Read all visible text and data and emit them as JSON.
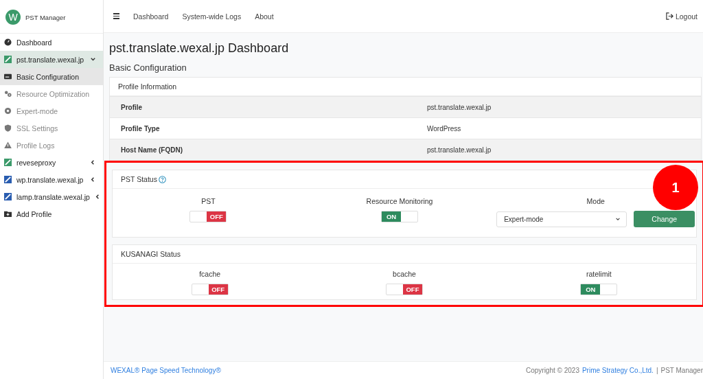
{
  "brand": {
    "logo": "W",
    "name": "PST Manager"
  },
  "sidebar": {
    "items": [
      {
        "kind": "link",
        "label": "Dashboard",
        "selected": false,
        "disabled": false
      },
      {
        "kind": "profile",
        "label": "pst.translate.wexal.jp",
        "selected": false,
        "expanded": true,
        "color": "#3b9a6a"
      },
      {
        "kind": "page",
        "label": "Basic Configuration",
        "selected": true,
        "disabled": false
      },
      {
        "kind": "page",
        "label": "Resource Optimization",
        "selected": false,
        "disabled": true
      },
      {
        "kind": "page",
        "label": "Expert-mode",
        "selected": false,
        "disabled": true
      },
      {
        "kind": "page",
        "label": "SSL Settings",
        "selected": false,
        "disabled": true
      },
      {
        "kind": "page",
        "label": "Profile Logs",
        "selected": false,
        "disabled": true
      },
      {
        "kind": "profile",
        "label": "reveseproxy",
        "selected": false,
        "expanded": false,
        "color": "#3b9a6a"
      },
      {
        "kind": "profile",
        "label": "wp.translate.wexal.jp",
        "selected": false,
        "expanded": false,
        "color": "#2a5db0"
      },
      {
        "kind": "profile",
        "label": "lamp.translate.wexal.jp",
        "selected": false,
        "expanded": false,
        "color": "#2a5db0"
      },
      {
        "kind": "link",
        "label": "Add Profile",
        "selected": false,
        "disabled": false
      }
    ]
  },
  "topbar": {
    "links": [
      "Dashboard",
      "System-wide Logs",
      "About"
    ],
    "logout": "Logout"
  },
  "page_title": "pst.translate.wexal.jp Dashboard",
  "section_title": "Basic Configuration",
  "profile_card": {
    "title": "Profile Information",
    "rows": [
      {
        "label": "Profile",
        "value": "pst.translate.wexal.jp"
      },
      {
        "label": "Profile Type",
        "value": "WordPress"
      },
      {
        "label": "Host Name (FQDN)",
        "value": "pst.translate.wexal.jp"
      }
    ]
  },
  "pst_status": {
    "title": "PST Status",
    "toggles": [
      {
        "label": "PST",
        "on": false,
        "text": "OFF"
      },
      {
        "label": "Resource Monitoring",
        "on": true,
        "text": "ON"
      }
    ],
    "mode": {
      "label": "Mode",
      "value": "Expert-mode",
      "button": "Change"
    }
  },
  "kusanagi_status": {
    "title": "KUSANAGI Status",
    "toggles": [
      {
        "label": "fcache",
        "on": false,
        "text": "OFF"
      },
      {
        "label": "bcache",
        "on": false,
        "text": "OFF"
      },
      {
        "label": "ratelimit",
        "on": true,
        "text": "ON"
      }
    ]
  },
  "annotation": {
    "number": "1"
  },
  "footer": {
    "left": "WEXAL® Page Speed Technology®",
    "copyright": "Copyright © 2023",
    "company": "Prime Strategy Co.,Ltd.",
    "separator": "|",
    "product": "PST Manager"
  }
}
